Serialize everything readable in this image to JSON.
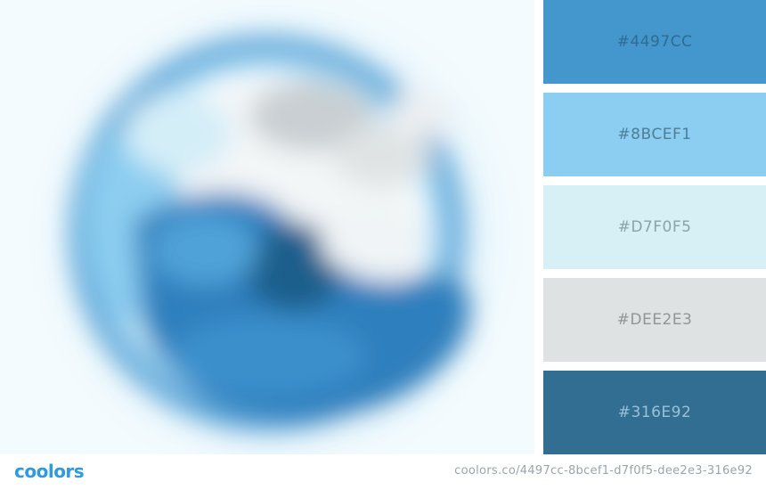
{
  "palette": {
    "swatches": [
      {
        "hex": "#4497CC",
        "label": "#4497CC",
        "text_color": "#2f6b92"
      },
      {
        "hex": "#8BCEF1",
        "label": "#8BCEF1",
        "text_color": "#4f7d96"
      },
      {
        "hex": "#D7F0F5",
        "label": "#D7F0F5",
        "text_color": "#8aa2a8"
      },
      {
        "hex": "#DEE2E3",
        "label": "#DEE2E3",
        "text_color": "#8f9698"
      },
      {
        "hex": "#316E92",
        "label": "#316E92",
        "text_color": "#9cc0d6"
      }
    ]
  },
  "footer": {
    "logo": "coolors",
    "palette_url": "coolors.co/4497cc-8bcef1-d7f0f5-dee2e3-316e92"
  },
  "colors": {
    "brand": "#2b9be3"
  },
  "image": {
    "icon_name": "wave-logo-icon"
  }
}
